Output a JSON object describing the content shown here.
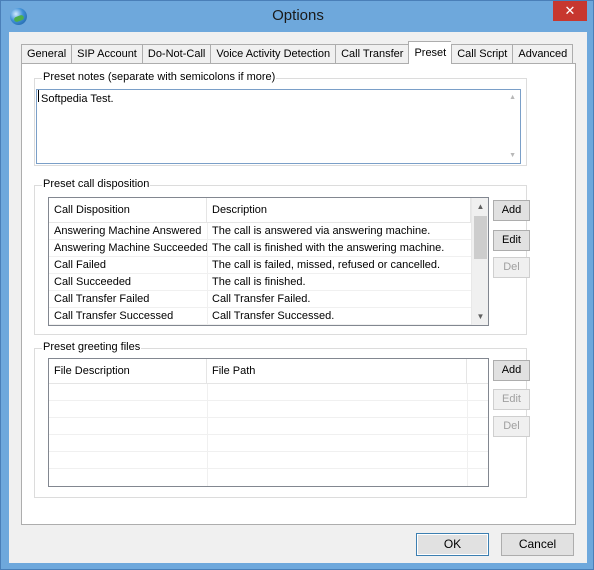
{
  "window": {
    "title": "Options",
    "close_glyph": "✕",
    "app_icon": "globe-phone-icon"
  },
  "tabs": [
    {
      "label": "General",
      "active": false
    },
    {
      "label": "SIP Account",
      "active": false
    },
    {
      "label": "Do-Not-Call",
      "active": false
    },
    {
      "label": "Voice Activity Detection",
      "active": false
    },
    {
      "label": "Call Transfer",
      "active": false
    },
    {
      "label": "Preset",
      "active": true
    },
    {
      "label": "Call Script",
      "active": false
    },
    {
      "label": "Advanced",
      "active": false
    }
  ],
  "preset_notes": {
    "label": "Preset notes (separate with semicolons if more)",
    "value": "Softpedia Test."
  },
  "call_disposition": {
    "label": "Preset call disposition",
    "columns": [
      "Call Disposition",
      "Description"
    ],
    "rows": [
      [
        "Answering Machine Answered",
        "The call is answered via answering machine."
      ],
      [
        "Answering Machine Succeeded",
        "The call is finished with the answering machine."
      ],
      [
        "Call Failed",
        "The call is failed, missed, refused or cancelled."
      ],
      [
        "Call Succeeded",
        "The call is finished."
      ],
      [
        "Call Transfer Failed",
        "Call Transfer Failed."
      ],
      [
        "Call Transfer Successed",
        "Call Transfer Successed."
      ]
    ],
    "buttons": {
      "add": "Add",
      "edit": "Edit",
      "del": "Del"
    }
  },
  "greeting_files": {
    "label": "Preset greeting files",
    "columns": [
      "File Description",
      "File Path"
    ],
    "rows": [],
    "buttons": {
      "add": "Add",
      "edit": "Edit",
      "del": "Del"
    }
  },
  "footer": {
    "ok": "OK",
    "cancel": "Cancel"
  }
}
